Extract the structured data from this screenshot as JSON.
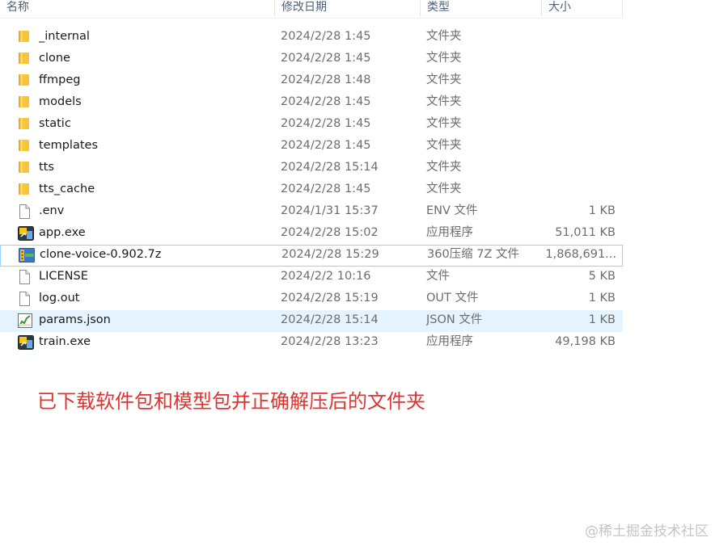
{
  "columns": {
    "name": "名称",
    "date": "修改日期",
    "type": "类型",
    "size": "大小"
  },
  "files": [
    {
      "icon": "folder-icon",
      "name": "_internal",
      "date": "2024/2/28 1:45",
      "type": "文件夹",
      "size": ""
    },
    {
      "icon": "folder-icon",
      "name": "clone",
      "date": "2024/2/28 1:45",
      "type": "文件夹",
      "size": ""
    },
    {
      "icon": "folder-icon",
      "name": "ffmpeg",
      "date": "2024/2/28 1:48",
      "type": "文件夹",
      "size": ""
    },
    {
      "icon": "folder-icon",
      "name": "models",
      "date": "2024/2/28 1:45",
      "type": "文件夹",
      "size": ""
    },
    {
      "icon": "folder-icon",
      "name": "static",
      "date": "2024/2/28 1:45",
      "type": "文件夹",
      "size": ""
    },
    {
      "icon": "folder-icon",
      "name": "templates",
      "date": "2024/2/28 1:45",
      "type": "文件夹",
      "size": ""
    },
    {
      "icon": "folder-icon",
      "name": "tts",
      "date": "2024/2/28 15:14",
      "type": "文件夹",
      "size": ""
    },
    {
      "icon": "folder-icon",
      "name": "tts_cache",
      "date": "2024/2/28 1:45",
      "type": "文件夹",
      "size": ""
    },
    {
      "icon": "blank-file-icon",
      "name": ".env",
      "date": "2024/1/31 15:37",
      "type": "ENV 文件",
      "size": "1 KB"
    },
    {
      "icon": "exe-app-icon",
      "name": "app.exe",
      "date": "2024/2/28 15:02",
      "type": "应用程序",
      "size": "51,011 KB"
    },
    {
      "icon": "archive-7z-icon",
      "name": "clone-voice-0.902.7z",
      "date": "2024/2/28 15:29",
      "type": "360压缩 7Z 文件",
      "size": "1,868,691...",
      "state": "selected"
    },
    {
      "icon": "blank-file-icon",
      "name": "LICENSE",
      "date": "2024/2/2 10:16",
      "type": "文件",
      "size": "5 KB"
    },
    {
      "icon": "blank-file-icon",
      "name": "log.out",
      "date": "2024/2/28 15:19",
      "type": "OUT 文件",
      "size": "1 KB"
    },
    {
      "icon": "json-file-icon",
      "name": "params.json",
      "date": "2024/2/28 15:14",
      "type": "JSON 文件",
      "size": "1 KB",
      "state": "hover"
    },
    {
      "icon": "exe-app-icon",
      "name": "train.exe",
      "date": "2024/2/28 13:23",
      "type": "应用程序",
      "size": "49,198 KB"
    }
  ],
  "caption": "已下载软件包和模型包并正确解压后的文件夹",
  "watermark": "@稀土掘金技术社区",
  "colors": {
    "caption": "#e0332f",
    "folder": "#f8c43a",
    "selection_border": "#99d1ff",
    "hover_background": "#e5f3ff"
  }
}
